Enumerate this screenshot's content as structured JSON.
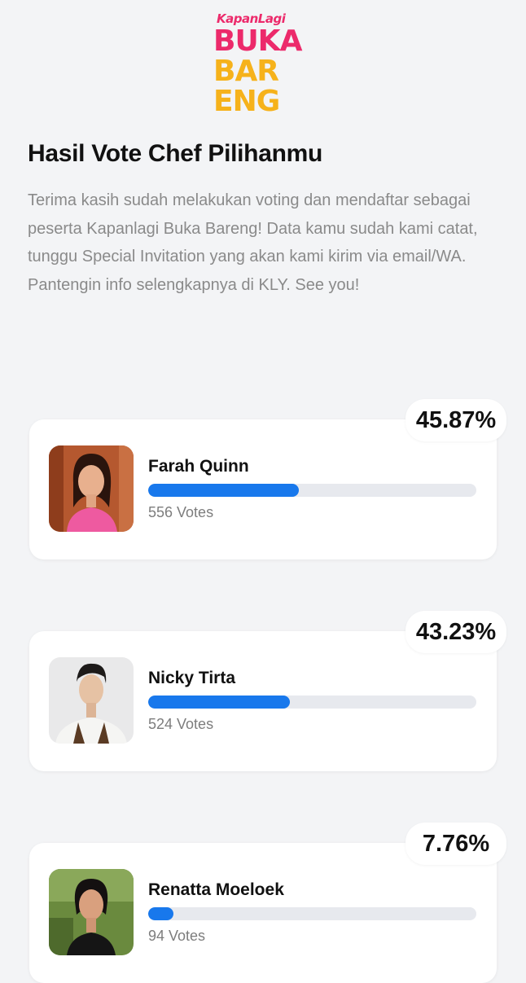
{
  "logo": {
    "brand": "KapanLagi",
    "lines": [
      "BUKA",
      "BAR",
      "ENG"
    ],
    "colors": {
      "pink": "#ec2a6b",
      "yellow": "#f6b21b"
    }
  },
  "title": "Hasil Vote Chef Pilihanmu",
  "intro": "Terima kasih sudah melakukan voting dan mendaftar sebagai peserta Kapanlagi Buka Bareng! Data kamu sudah kami catat, tunggu Special Invitation yang akan kami kirim via email/WA. Pantengin info selengkapnya di KLY. See you!",
  "accent_color": "#1878ec",
  "chefs": [
    {
      "name": "Farah Quinn",
      "percent": "45.87%",
      "votes": "556 Votes",
      "fill_percent": 45.87
    },
    {
      "name": "Nicky Tirta",
      "percent": "43.23%",
      "votes": "524 Votes",
      "fill_percent": 43.23
    },
    {
      "name": "Renatta Moeloek",
      "percent": "7.76%",
      "votes": "94 Votes",
      "fill_percent": 7.76
    }
  ]
}
